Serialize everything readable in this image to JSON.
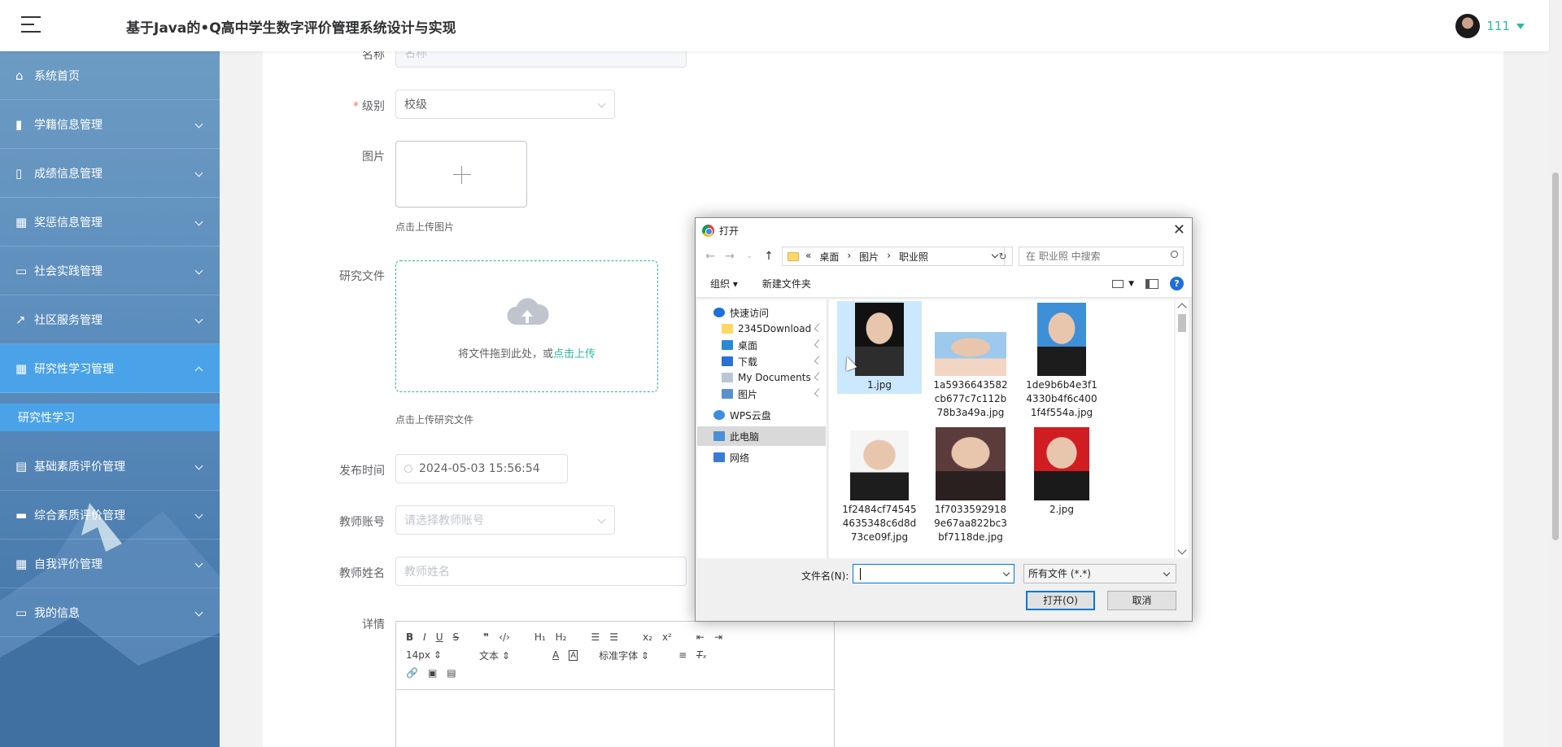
{
  "app": {
    "title": "基于Java的•Q高中学生数字评价管理系统设计与实现",
    "user": "111",
    "accent_color": "#2ab9a0"
  },
  "sidebar": {
    "items": [
      {
        "label": "系统首页",
        "icon": "home-icon",
        "expandable": false
      },
      {
        "label": "学籍信息管理",
        "icon": "bar-chart-icon",
        "expandable": true
      },
      {
        "label": "成绩信息管理",
        "icon": "book-icon",
        "expandable": true
      },
      {
        "label": "奖惩信息管理",
        "icon": "grid-icon",
        "expandable": true
      },
      {
        "label": "社会实践管理",
        "icon": "chat-icon",
        "expandable": true
      },
      {
        "label": "社区服务管理",
        "icon": "line-chart-icon",
        "expandable": true
      },
      {
        "label": "研究性学习管理",
        "icon": "grid-icon",
        "expandable": true,
        "open": true
      },
      {
        "label": "基础素质评价管理",
        "icon": "clipboard-icon",
        "expandable": true
      },
      {
        "label": "综合素质评价管理",
        "icon": "monitor-icon",
        "expandable": true
      },
      {
        "label": "自我评价管理",
        "icon": "grid-icon",
        "expandable": true
      },
      {
        "label": "我的信息",
        "icon": "card-icon",
        "expandable": true
      }
    ],
    "active_sub": "研究性学习"
  },
  "form": {
    "name_label": "名称",
    "name_placeholder": "名称",
    "level_label": "级别",
    "level_value": "校级",
    "image_label": "图片",
    "image_tip": "点击上传图片",
    "file_label": "研究文件",
    "drag_text": "将文件拖到此处，或",
    "drag_link": "点击上传",
    "file_tip": "点击上传研究文件",
    "time_label": "发布时间",
    "time_value": "2024-05-03 15:56:54",
    "teacher_account_label": "教师账号",
    "teacher_account_placeholder": "请选择教师账号",
    "teacher_name_label": "教师姓名",
    "teacher_name_placeholder": "教师姓名",
    "detail_label": "详情",
    "editor": {
      "font_size": "14px",
      "block": "文本",
      "font": "标准字体"
    }
  },
  "dialog": {
    "title": "打开",
    "breadcrumb": [
      "«",
      "桌面",
      "›",
      "图片",
      "›",
      "职业照"
    ],
    "search_placeholder": "在 职业照 中搜索",
    "organize": "组织 ▾",
    "new_folder": "新建文件夹",
    "nav": [
      {
        "label": "快速访问",
        "icon": "star-icon"
      },
      {
        "label": "2345Download",
        "icon": "folder-icon",
        "pinned": true
      },
      {
        "label": "桌面",
        "icon": "desktop-icon",
        "pinned": true
      },
      {
        "label": "下载",
        "icon": "download-icon",
        "pinned": true
      },
      {
        "label": "My Documents",
        "icon": "document-icon",
        "pinned": true
      },
      {
        "label": "图片",
        "icon": "picture-icon",
        "pinned": true
      },
      {
        "label": "WPS云盘",
        "icon": "cloud-icon"
      },
      {
        "label": "此电脑",
        "icon": "computer-icon",
        "selected": true
      },
      {
        "label": "网络",
        "icon": "network-icon"
      }
    ],
    "files": [
      {
        "name": "1.jpg",
        "selected": true
      },
      {
        "name": "1a5936643582cb677c7c112b78b3a49a.jpg"
      },
      {
        "name": "1de9b6b4e3f14330b4f6c4001f4f554a.jpg"
      },
      {
        "name": "1f2484cf745454635348c6d8d73ce09f.jpg"
      },
      {
        "name": "1f70335929189e67aa822bc3bf7118de.jpg"
      },
      {
        "name": "2.jpg"
      }
    ],
    "filename_label": "文件名(N):",
    "filename_value": "",
    "filetype": "所有文件 (*.*)",
    "open_btn": "打开(O)",
    "cancel_btn": "取消"
  }
}
